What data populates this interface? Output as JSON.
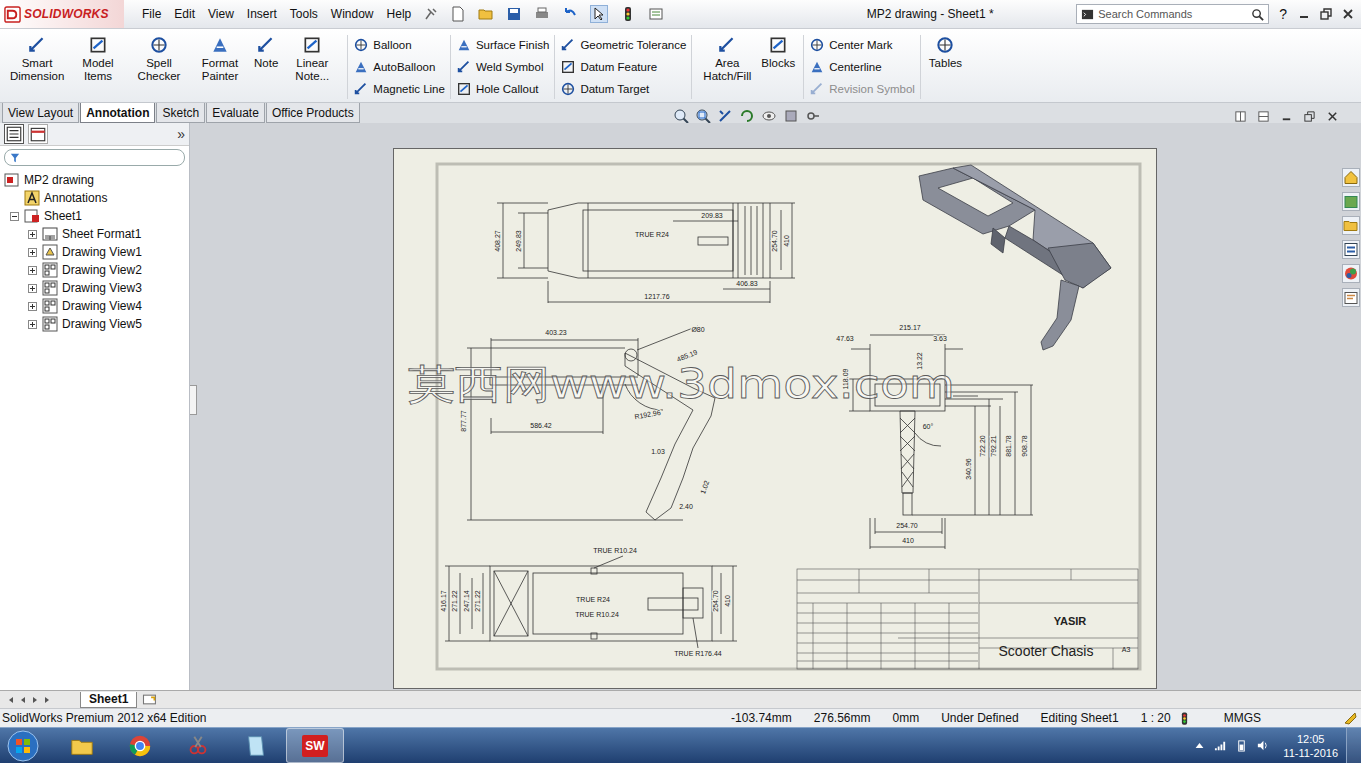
{
  "window": {
    "title": "MP2 drawing - Sheet1 *"
  },
  "app": {
    "logo": "SOLIDWORKS"
  },
  "menu": [
    "File",
    "Edit",
    "View",
    "Insert",
    "Tools",
    "Window",
    "Help"
  ],
  "search": {
    "placeholder": "Search Commands"
  },
  "help": "?",
  "ribbon": [
    {
      "kind": "large",
      "items": [
        {
          "label": "Smart Dimension",
          "disabled": false
        },
        {
          "label": "Model Items",
          "disabled": false
        },
        {
          "label": "Spell Checker",
          "disabled": false
        },
        {
          "label": "Format Painter",
          "disabled": false
        },
        {
          "label": "Note",
          "disabled": false
        },
        {
          "label": "Linear Note...",
          "disabled": false
        }
      ]
    },
    {
      "kind": "stack",
      "items": [
        {
          "label": "Balloon",
          "disabled": false
        },
        {
          "label": "AutoBalloon",
          "disabled": false
        },
        {
          "label": "Magnetic Line",
          "disabled": false
        }
      ]
    },
    {
      "kind": "stack",
      "items": [
        {
          "label": "Surface Finish",
          "disabled": false
        },
        {
          "label": "Weld Symbol",
          "disabled": false
        },
        {
          "label": "Hole Callout",
          "disabled": false
        }
      ]
    },
    {
      "kind": "stack",
      "items": [
        {
          "label": "Geometric Tolerance",
          "disabled": false
        },
        {
          "label": "Datum Feature",
          "disabled": false
        },
        {
          "label": "Datum Target",
          "disabled": false
        }
      ]
    },
    {
      "kind": "large",
      "items": [
        {
          "label": "Area Hatch/Fill",
          "disabled": false
        },
        {
          "label": "Blocks",
          "disabled": false
        }
      ]
    },
    {
      "kind": "stack",
      "items": [
        {
          "label": "Center Mark",
          "disabled": false
        },
        {
          "label": "Centerline",
          "disabled": false
        },
        {
          "label": "Revision Symbol",
          "disabled": true
        }
      ]
    },
    {
      "kind": "large",
      "items": [
        {
          "label": "Tables",
          "disabled": false
        }
      ]
    }
  ],
  "tabs": [
    {
      "label": "View Layout",
      "selected": false
    },
    {
      "label": "Annotation",
      "selected": true
    },
    {
      "label": "Sketch",
      "selected": false
    },
    {
      "label": "Evaluate",
      "selected": false
    },
    {
      "label": "Office Products",
      "selected": false
    }
  ],
  "panel": {
    "collapse": "»"
  },
  "tree": [
    {
      "label": "MP2 drawing",
      "kind": "drawing",
      "expandable": false,
      "expanded": true,
      "children": [
        {
          "label": "Annotations",
          "kind": "annotations",
          "expandable": false,
          "expanded": false,
          "children": []
        },
        {
          "label": "Sheet1",
          "kind": "sheet",
          "expandable": true,
          "expanded": true,
          "children": [
            {
              "label": "Sheet Format1",
              "kind": "format",
              "expandable": true,
              "expanded": false,
              "children": []
            },
            {
              "label": "Drawing View1",
              "kind": "view-iso",
              "expandable": true,
              "expanded": false,
              "children": []
            },
            {
              "label": "Drawing View2",
              "kind": "view",
              "expandable": true,
              "expanded": false,
              "children": []
            },
            {
              "label": "Drawing View3",
              "kind": "view",
              "expandable": true,
              "expanded": false,
              "children": []
            },
            {
              "label": "Drawing View4",
              "kind": "view",
              "expandable": true,
              "expanded": false,
              "children": []
            },
            {
              "label": "Drawing View5",
              "kind": "view",
              "expandable": true,
              "expanded": false,
              "children": []
            }
          ]
        }
      ]
    }
  ],
  "sheet": {
    "watermark": "莫西网www.3dmox.com",
    "views": [
      {
        "name": "top-view",
        "dims": [
          "408.27",
          "249.83",
          "209.83",
          "TRUE R24",
          "254.70",
          "410",
          "406.83",
          "1217.76"
        ]
      },
      {
        "name": "side-view",
        "dims": [
          "403.23",
          "Ø80",
          "485.19",
          "586.42",
          "R192.96",
          "877.77",
          "1.03",
          "1.02",
          "2.40"
        ]
      },
      {
        "name": "front-view",
        "dims": [
          "47.63",
          "215.17",
          "3.63",
          "118.09",
          "13.22",
          "60°",
          "340.96",
          "722.20",
          "792.21",
          "881.78",
          "908.78",
          "254.70",
          "410"
        ]
      },
      {
        "name": "bottom-view",
        "dims": [
          "TRUE R10.24",
          "TRUE R24",
          "TRUE R10.24",
          "TRUE R176.44",
          "416.17",
          "271.22",
          "247.14",
          "271.22",
          "254.70",
          "410"
        ]
      }
    ],
    "title_block": {
      "designer": "YASIR",
      "title": "Scooter Chasis",
      "size": "A3"
    }
  },
  "sheet_tabs": [
    {
      "label": "Sheet1",
      "selected": true
    }
  ],
  "status_bar": {
    "edition": "SolidWorks Premium 2012 x64 Edition",
    "x": "-103.74mm",
    "y": "276.56mm",
    "z": "0mm",
    "state": "Under Defined",
    "editing": "Editing Sheet1",
    "scale": "1 : 20",
    "units": "MMGS"
  },
  "taskbar": {
    "sw_badge": "SW",
    "time": "12:05",
    "date": "11-11-2016"
  }
}
